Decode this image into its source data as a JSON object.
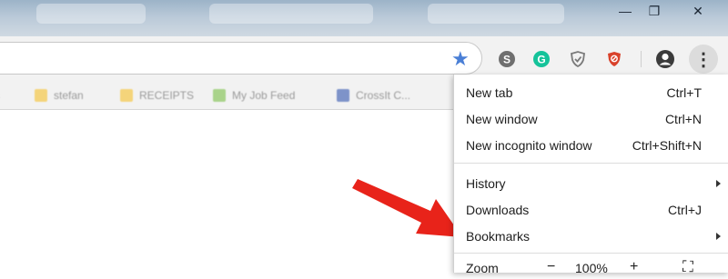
{
  "window": {
    "minimize_glyph": "—",
    "restore_glyph": "❐",
    "close_glyph": "✕"
  },
  "toolbar": {
    "star_glyph": "★",
    "extensions": [
      {
        "name": "skype-icon",
        "letter": "S",
        "color": "#6d6d6d"
      },
      {
        "name": "grammarly-icon",
        "letter": "G",
        "color": "#15c39a"
      },
      {
        "name": "shield-check-icon",
        "letter": "",
        "color": "#7a7a7a"
      },
      {
        "name": "adblock-icon",
        "letter": "",
        "color": "#d9422b"
      }
    ],
    "menu_glyph": "⋮"
  },
  "bookmarks": [
    {
      "label": "stefan",
      "color": "#f4d47a"
    },
    {
      "label": "RECEIPTS",
      "color": "#f4d47a"
    },
    {
      "label": "My Job Feed",
      "color": "#a9d38a"
    },
    {
      "label": "CrossIt C...",
      "color": "#7e93c9"
    }
  ],
  "menu": {
    "group1": [
      {
        "label": "New tab",
        "shortcut": "Ctrl+T"
      },
      {
        "label": "New window",
        "shortcut": "Ctrl+N"
      },
      {
        "label": "New incognito window",
        "shortcut": "Ctrl+Shift+N"
      }
    ],
    "group2": [
      {
        "label": "History",
        "shortcut": "",
        "submenu": true
      },
      {
        "label": "Downloads",
        "shortcut": "Ctrl+J",
        "submenu": false
      },
      {
        "label": "Bookmarks",
        "shortcut": "",
        "submenu": true
      }
    ],
    "zoom": {
      "label": "Zoom",
      "minus": "−",
      "value": "100%",
      "plus": "+",
      "fullscreen_glyph": "⛶"
    }
  },
  "annotation": {
    "arrow_color": "#e8231a"
  }
}
